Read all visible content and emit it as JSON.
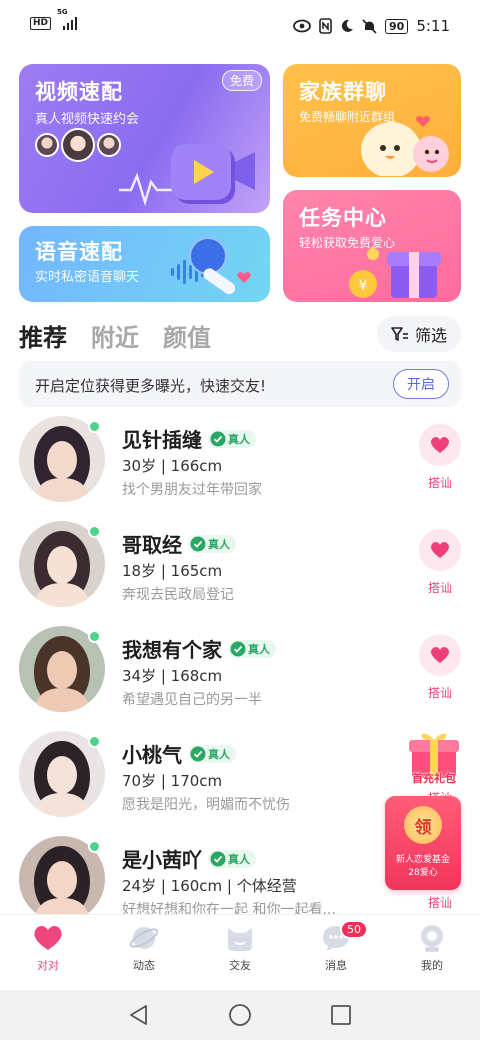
{
  "status_bar": {
    "hd": "HD",
    "network": "5G",
    "battery": "90",
    "time": "5:11"
  },
  "cards": {
    "video": {
      "title": "视频速配",
      "subtitle": "真人视频快速约会",
      "badge": "免费"
    },
    "family": {
      "title": "家族群聊",
      "subtitle": "免费畅聊附近群组"
    },
    "voice": {
      "title": "语音速配",
      "subtitle": "实时私密语音聊天"
    },
    "task": {
      "title": "任务中心",
      "subtitle": "轻松获取免费爱心"
    }
  },
  "tabs": {
    "items": [
      {
        "label": "推荐",
        "active": true
      },
      {
        "label": "附近",
        "active": false
      },
      {
        "label": "颜值",
        "active": false
      }
    ],
    "filter_label": "筛选"
  },
  "location_banner": {
    "text": "开启定位获得更多曝光，快速交友!",
    "button": "开启"
  },
  "users": [
    {
      "name": "见针插缝",
      "verified": "真人",
      "meta": "30岁 | 166cm",
      "bio": "找个男朋友过年带回家",
      "action": "搭讪",
      "online": true
    },
    {
      "name": "哥取经",
      "verified": "真人",
      "meta": "18岁 | 165cm",
      "bio": "奔现去民政局登记",
      "action": "搭讪",
      "online": true
    },
    {
      "name": "我想有个家",
      "verified": "真人",
      "meta": "34岁 | 168cm",
      "bio": "希望遇见自己的另一半",
      "action": "搭讪",
      "online": true
    },
    {
      "name": "小桃气",
      "verified": "真人",
      "meta": "70岁 | 170cm",
      "bio": "愿我是阳光，明媚而不忧伤",
      "action": "搭讪",
      "online": true
    },
    {
      "name": "是小茜吖",
      "verified": "真人",
      "meta": "24岁 | 160cm | 个体经营",
      "bio": "好想好想和你在一起 和你一起看...",
      "action": "搭讪",
      "online": true
    }
  ],
  "promos": {
    "gift_label": "首充礼包",
    "redpack_coin": "领",
    "redpack_line1": "新人恋爱基金",
    "redpack_line2": "28爱心"
  },
  "bottom_nav": {
    "items": [
      {
        "label": "对对",
        "icon": "heart-icon",
        "active": true
      },
      {
        "label": "动态",
        "icon": "planet-icon",
        "active": false
      },
      {
        "label": "交友",
        "icon": "cat-face-icon",
        "active": false
      },
      {
        "label": "消息",
        "icon": "chat-bubble-icon",
        "active": false,
        "badge": "50"
      },
      {
        "label": "我的",
        "icon": "profile-icon",
        "active": false
      }
    ]
  },
  "colors": {
    "accent_pink": "#e8467c",
    "video_card": "#8a6cf0",
    "family_card": "#ffae3c",
    "voice_card": "#73c4f6",
    "task_card": "#ff6b9d",
    "online_dot": "#4cd38c",
    "verified_green": "#2aa765"
  }
}
